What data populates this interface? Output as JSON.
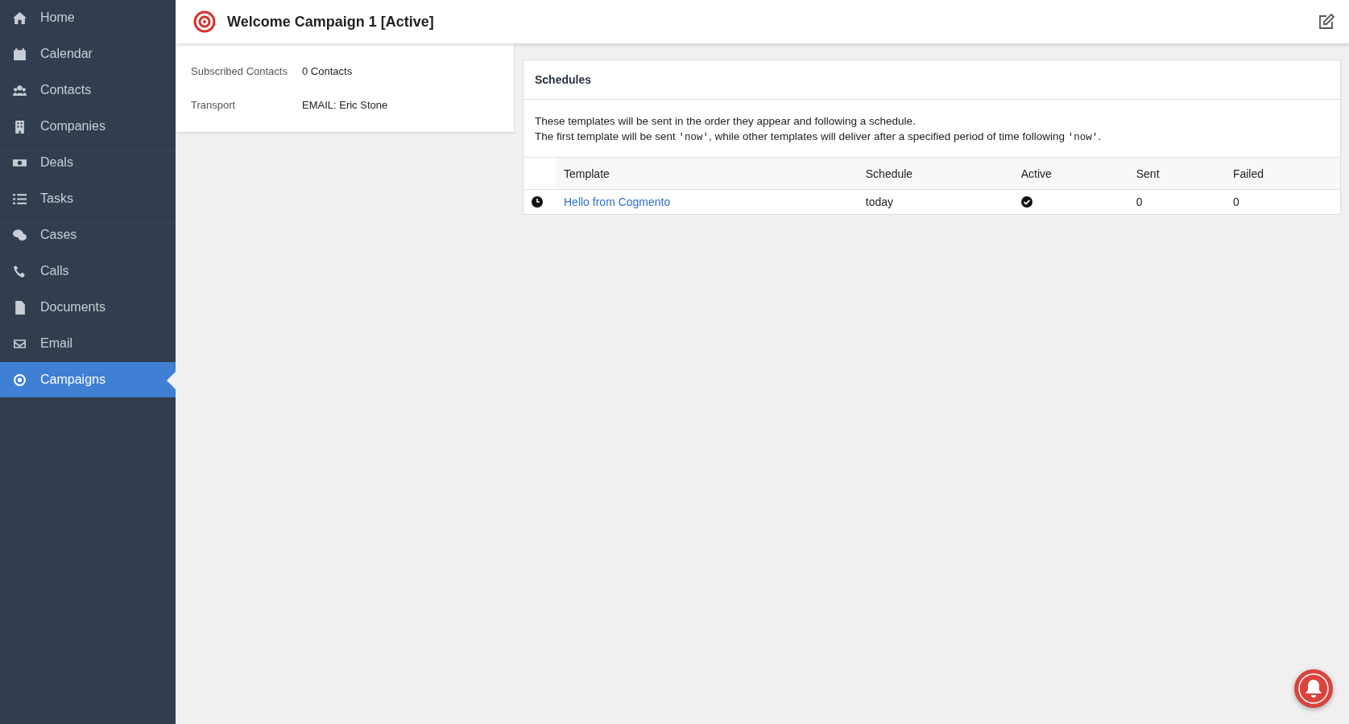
{
  "sidebar": {
    "items": [
      {
        "label": "Home",
        "selected": false
      },
      {
        "label": "Calendar",
        "selected": false
      },
      {
        "label": "Contacts",
        "selected": false
      },
      {
        "label": "Companies",
        "selected": false
      },
      {
        "label": "Deals",
        "selected": false
      },
      {
        "label": "Tasks",
        "selected": false
      },
      {
        "label": "Cases",
        "selected": false
      },
      {
        "label": "Calls",
        "selected": false
      },
      {
        "label": "Documents",
        "selected": false
      },
      {
        "label": "Email",
        "selected": false
      },
      {
        "label": "Campaigns",
        "selected": true
      }
    ]
  },
  "header": {
    "title": "Welcome Campaign 1 [Active]"
  },
  "details": [
    {
      "label": "Subscribed Contacts",
      "value": "0 Contacts"
    },
    {
      "label": "Transport",
      "value": "EMAIL: Eric Stone"
    }
  ],
  "schedules": {
    "title": "Schedules",
    "paragraphs": [
      [
        {
          "kind": "text",
          "text": "These templates will be sent in the order they appear and following a schedule."
        }
      ],
      [
        {
          "kind": "text",
          "text": "The first template will be sent "
        },
        {
          "kind": "code",
          "text": "'now'"
        },
        {
          "kind": "text",
          "text": ", while other templates will deliver after a specified period of time following "
        },
        {
          "kind": "code",
          "text": "'now'"
        },
        {
          "kind": "text",
          "text": "."
        }
      ]
    ],
    "columns": [
      "Template",
      "Schedule",
      "Active",
      "Sent",
      "Failed"
    ],
    "rows": [
      {
        "template": "Hello from Cogmento",
        "schedule": "today",
        "active": true,
        "sent": "0",
        "failed": "0"
      }
    ]
  }
}
